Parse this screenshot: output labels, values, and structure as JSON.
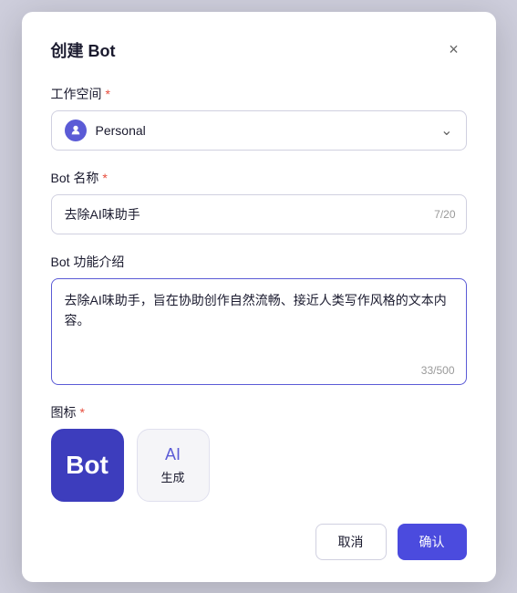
{
  "dialog": {
    "title": "创建 Bot",
    "close_label": "×"
  },
  "workspace": {
    "label": "工作空间",
    "required": "*",
    "value": "Personal"
  },
  "bot_name": {
    "label": "Bot 名称",
    "required": "*",
    "value": "去除AI味助手",
    "char_count": "7/20"
  },
  "bot_description": {
    "label": "Bot 功能介绍",
    "value": "去除AI味助手，旨在协助创作自然流畅、接近人类写作风格的文本内容。",
    "char_count": "33/500"
  },
  "icon": {
    "label": "图标",
    "required": "*",
    "bot_text": "Bot",
    "generate_label": "生成",
    "generate_icon": "AI"
  },
  "footer": {
    "cancel_label": "取消",
    "confirm_label": "确认"
  }
}
